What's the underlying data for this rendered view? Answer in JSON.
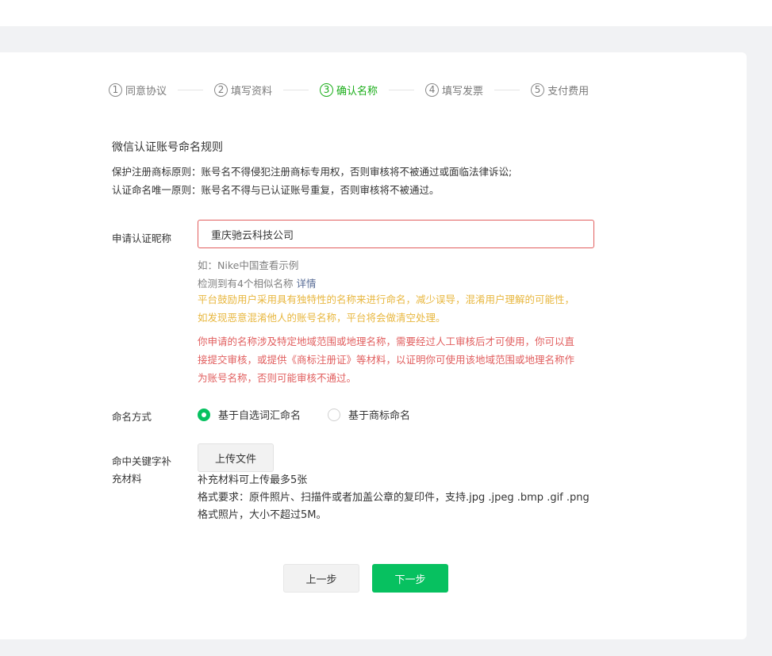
{
  "steps": [
    {
      "num": "1",
      "label": "同意协议"
    },
    {
      "num": "2",
      "label": "填写资料"
    },
    {
      "num": "3",
      "label": "确认名称"
    },
    {
      "num": "4",
      "label": "填写发票"
    },
    {
      "num": "5",
      "label": "支付费用"
    }
  ],
  "active_step": 3,
  "rules": {
    "title": "微信认证账号命名规则",
    "line1": "保护注册商标原则：账号名不得侵犯注册商标专用权，否则审核将不被通过或面临法律诉讼;",
    "line2": "认证命名唯一原则：账号名不得与已认证账号重复，否则审核将不被通过。"
  },
  "nickname": {
    "label": "申请认证昵称",
    "value": "重庆驰云科技公司",
    "example_prefix": "如：",
    "example_link": "Nike中国查看示例",
    "similar_text": "检测到有4个相似名称 ",
    "similar_link": "详情",
    "warn_line1": "平台鼓励用户采用具有独特性的名称来进行命名，减少误导，混淆用户理解的可能性，",
    "warn_line2": "如发现恶意混淆他人的账号名称，平台将会做清空处理。",
    "err_line1": "你申请的名称涉及特定地域范围或地理名称，需要经过人工审核后才可使用，你可以直",
    "err_line2": "接提交审核，或提供《商标注册证》等材料，以证明你可使用该地域范围或地理名称作",
    "err_line3": "为账号名称，否则可能审核不通过。"
  },
  "naming": {
    "label": "命名方式",
    "option1": "基于自选词汇命名",
    "option2": "基于商标命名",
    "selected": 1
  },
  "materials": {
    "label_line1": "命中关键字补",
    "label_line2": "充材料",
    "upload_label": "上传文件",
    "note1": "补充材料可上传最多5张",
    "note2": "格式要求：原件照片、扫描件或者加盖公章的复印件，支持.jpg .jpeg .bmp .gif .png",
    "note3": "格式照片，大小不超过5M。"
  },
  "buttons": {
    "prev": "上一步",
    "next": "下一步"
  },
  "colors": {
    "accent": "#07c160",
    "error": "#e15f5f",
    "warning": "#e8b73f",
    "link": "#576b95"
  }
}
